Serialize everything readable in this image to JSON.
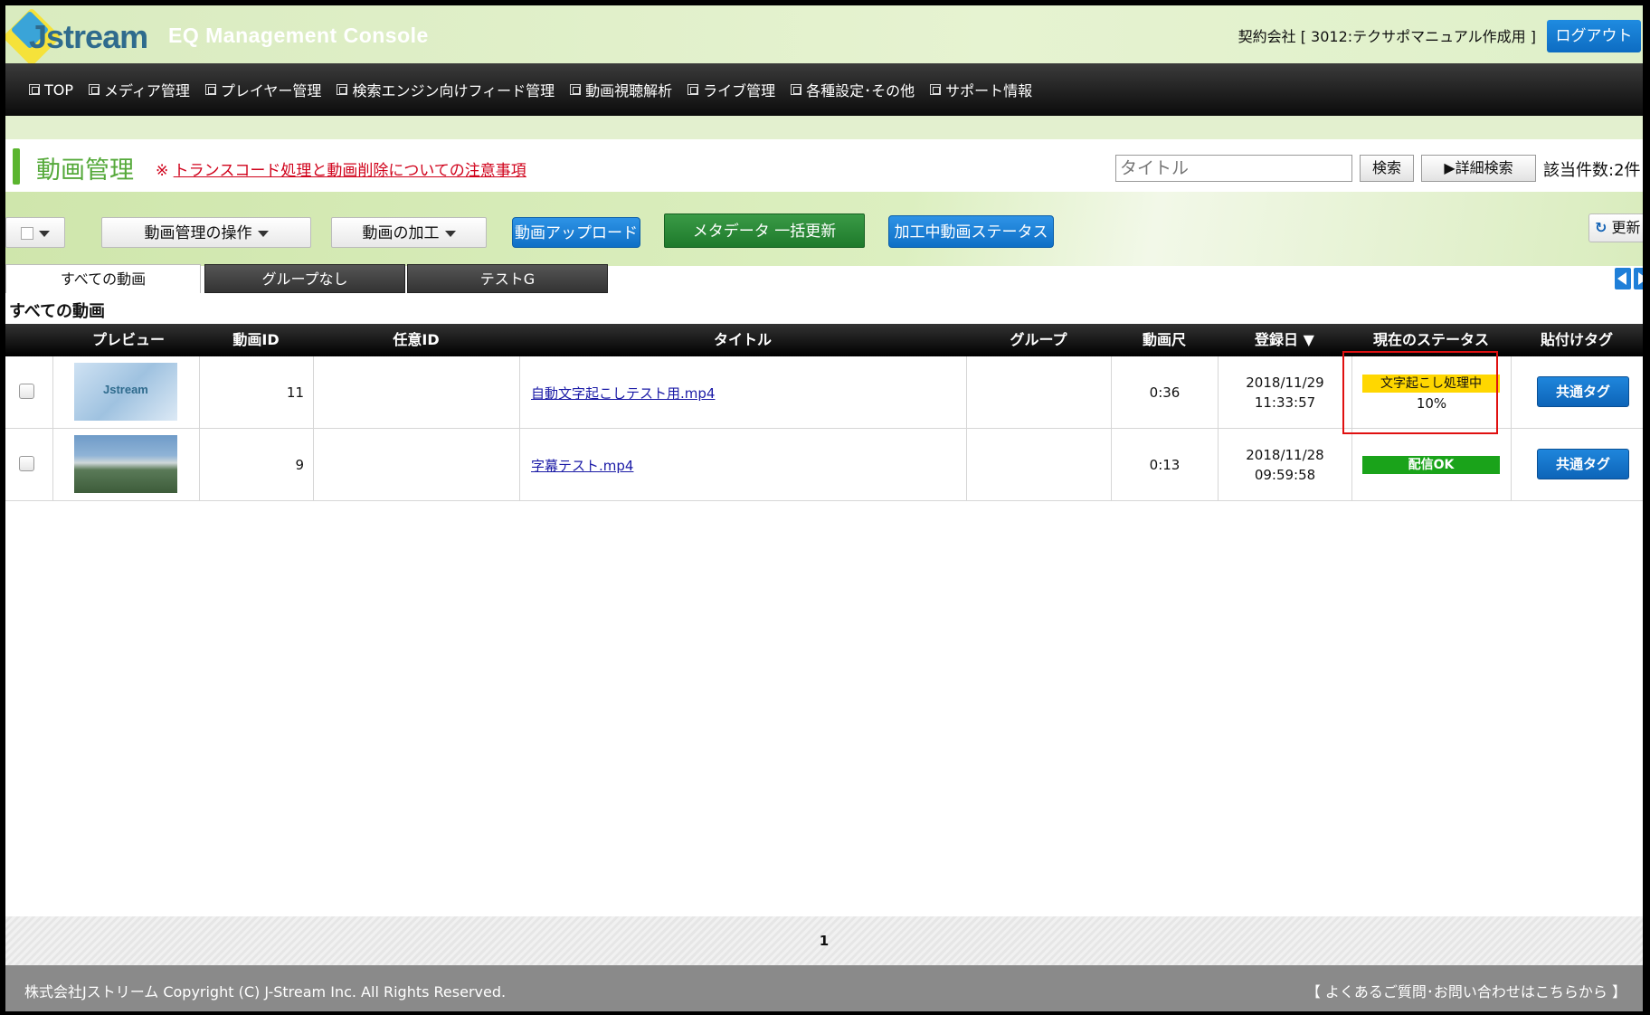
{
  "header": {
    "logo_text": "Jstream",
    "console_title": "EQ Management Console",
    "company": "契約会社 [ 3012:テクサポマニュアル作成用 ]",
    "logout": "ログアウト"
  },
  "nav": [
    "TOP",
    "メディア管理",
    "プレイヤー管理",
    "検索エンジン向けフィード管理",
    "動画視聴解析",
    "ライブ管理",
    "各種設定･その他",
    "サポート情報"
  ],
  "titlebar": {
    "title": "動画管理",
    "notice_mark": "※",
    "notice_link": "トランスコード処理と動画削除についての注意事項",
    "search_placeholder": "タイトル",
    "search_button": "検索",
    "advanced_search": "▶詳細検索",
    "count": "該当件数:2件"
  },
  "toolbar": {
    "manage_ops": "動画管理の操作",
    "processing": "動画の加工",
    "upload": "動画アップロード",
    "bulk_meta": "メタデータ 一括更新",
    "status": "加工中動画ステータス",
    "refresh_icon": "↻",
    "refresh": "更新"
  },
  "tabs": [
    "すべての動画",
    "グループなし",
    "テストG"
  ],
  "section_title": "すべての動画",
  "table": {
    "headers": [
      "プレビュー",
      "動画ID",
      "任意ID",
      "タイトル",
      "グループ",
      "動画尺",
      "登録日 ▼",
      "現在のステータス",
      "貼付けタグ"
    ],
    "rows": [
      {
        "id": "11",
        "custom_id": "",
        "title": "自動文字起こしテスト用.mp4",
        "group": "",
        "duration": "0:36",
        "date": "2018/11/29",
        "time": "11:33:57",
        "status": "文字起こし処理中",
        "status_color": "#ffd700",
        "progress": "10%",
        "tag": "共通タグ",
        "thumb_text": "Jstream"
      },
      {
        "id": "9",
        "custom_id": "",
        "title": "字幕テスト.mp4",
        "group": "",
        "duration": "0:13",
        "date": "2018/11/28",
        "time": "09:59:58",
        "status": "配信OK",
        "status_color": "#1aa31a",
        "progress": "",
        "tag": "共通タグ",
        "thumb_text": ""
      }
    ]
  },
  "pager": {
    "current": "1"
  },
  "footer": {
    "copyright": "株式会社Jストリーム Copyright (C) J-Stream Inc. All Rights Reserved.",
    "help": "【 よくあるご質問･お問い合わせはこちらから 】"
  }
}
